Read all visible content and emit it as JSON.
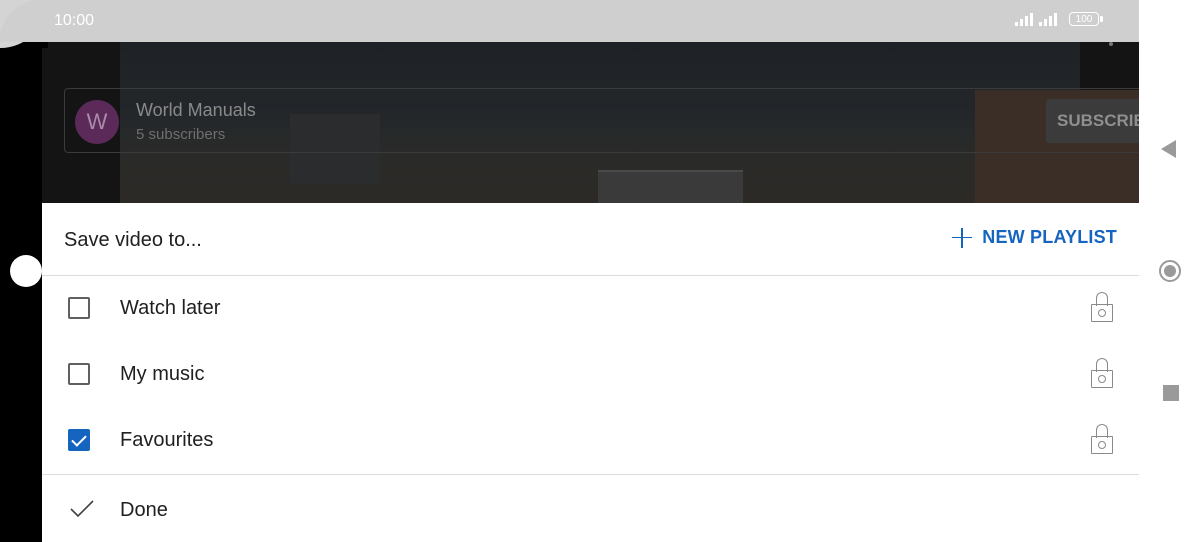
{
  "status_bar": {
    "time": "10:00",
    "battery": "100"
  },
  "video": {
    "channel_initial": "W",
    "channel_name": "World Manuals",
    "subscriber_count": "5 subscribers",
    "subscribe_label": "SUBSCRIBE"
  },
  "sheet": {
    "title": "Save video to...",
    "new_playlist_label": "NEW PLAYLIST",
    "playlists": [
      {
        "label": "Watch later",
        "checked": false,
        "privacy_icon": "lock-icon"
      },
      {
        "label": "My music",
        "checked": false,
        "privacy_icon": "lock-icon"
      },
      {
        "label": "Favourites",
        "checked": true,
        "privacy_icon": "lock-icon"
      }
    ],
    "done_label": "Done"
  },
  "colors": {
    "accent": "#1565c0",
    "status_bar": "#cfcfcf"
  }
}
